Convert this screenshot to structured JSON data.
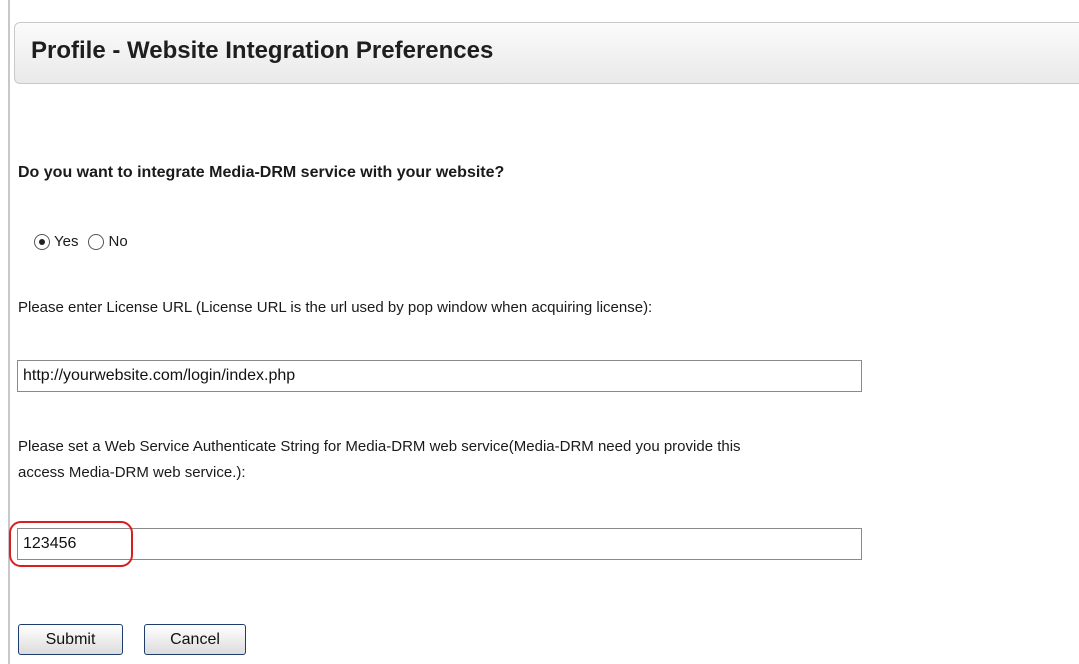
{
  "header": {
    "title": "Profile - Website Integration Preferences"
  },
  "question": "Do you want to integrate Media-DRM service with your website?",
  "integrate": {
    "options": [
      {
        "label": "Yes",
        "checked": true
      },
      {
        "label": "No",
        "checked": false
      }
    ]
  },
  "license_url": {
    "label": "Please enter License URL (License URL is the url used by pop window when acquiring license):",
    "value": "http://yourwebsite.com/login/index.php"
  },
  "auth_string": {
    "label_line1": "Please set a Web Service Authenticate String for Media-DRM web service(Media-DRM need you provide this",
    "label_line2": "access Media-DRM web service.):",
    "value": "123456"
  },
  "buttons": {
    "submit": "Submit",
    "cancel": "Cancel"
  },
  "highlight_color": "#d81e1e"
}
